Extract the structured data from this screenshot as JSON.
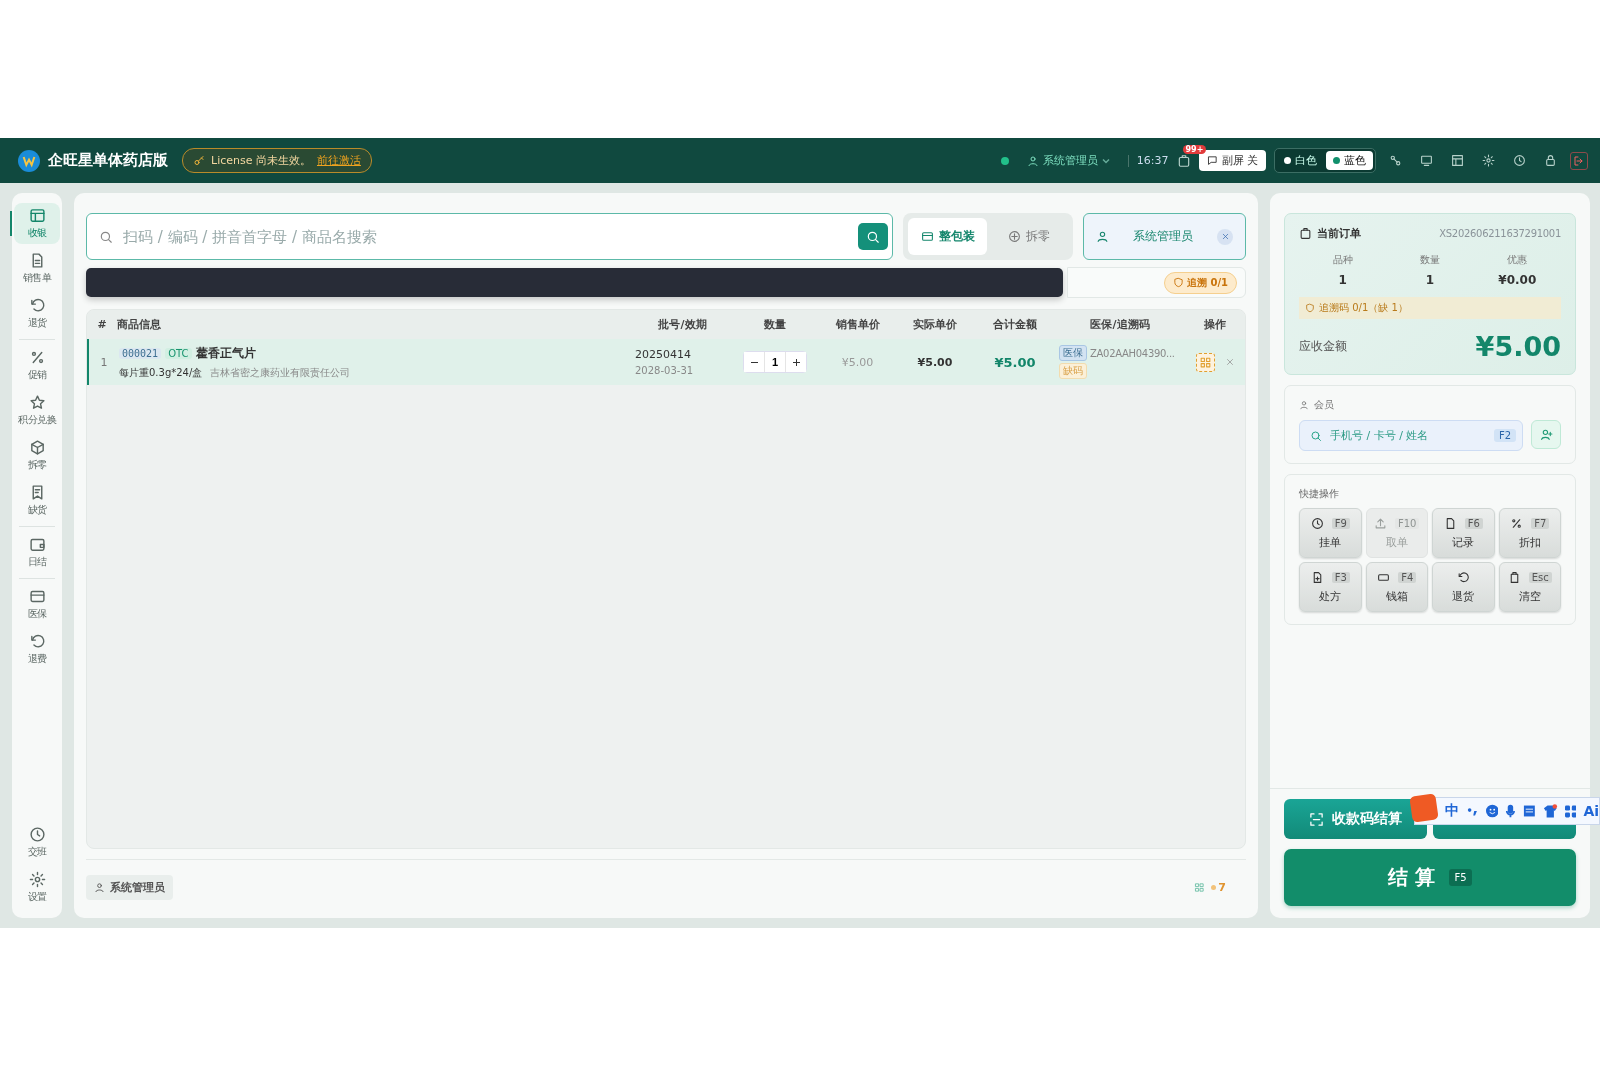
{
  "header": {
    "app_title": "企旺星单体药店版",
    "license_text": "License 尚未生效。",
    "license_link": "前往激活",
    "online": true,
    "user": "系统管理员",
    "time": "16:37",
    "notification_badge": "99+",
    "second_screen": "副屏 关",
    "themes": [
      {
        "label": "白色",
        "selected": false
      },
      {
        "label": "蓝色",
        "selected": true
      }
    ]
  },
  "sidebar": {
    "groups": [
      [
        {
          "label": "收银",
          "selected": true
        },
        {
          "label": "销售单",
          "selected": false
        },
        {
          "label": "退货",
          "selected": false
        }
      ],
      [
        {
          "label": "促销",
          "selected": false
        },
        {
          "label": "积分兑换",
          "selected": false
        },
        {
          "label": "拆零",
          "selected": false
        },
        {
          "label": "缺货",
          "selected": false
        }
      ],
      [
        {
          "label": "日结",
          "selected": false
        }
      ],
      [
        {
          "label": "医保",
          "selected": false
        },
        {
          "label": "退费",
          "selected": false
        }
      ]
    ],
    "bottom_items": [
      {
        "label": "交班",
        "selected": false
      },
      {
        "label": "设置",
        "selected": false
      }
    ]
  },
  "search": {
    "placeholder": "扫码 / 编码 / 拼音首字母 / 商品名搜索"
  },
  "pack_modes": [
    {
      "label": "整包装",
      "selected": true
    },
    {
      "label": "拆零",
      "selected": false
    }
  ],
  "cashier_chip": "系统管理员",
  "trace_badge": "追溯 0/1",
  "table": {
    "columns": [
      "#",
      "商品信息",
      "批号/效期",
      "数量",
      "销售单价",
      "实际单价",
      "合计金额",
      "医保/追溯码",
      "操作"
    ],
    "rows": [
      {
        "index": "1",
        "selected": true,
        "code": "000021",
        "tag": "OTC",
        "name": "藿香正气片",
        "spec": "每片重0.3g*24/盒",
        "maker": "吉林省密之康药业有限责任公司",
        "batch": "20250414",
        "expiry": "2028-03-31",
        "qty": "1",
        "sale_price": "¥5.00",
        "actual_price": "¥5.00",
        "total": "¥5.00",
        "insurance_tag": "医保",
        "trace_code": "ZA02AAH04390...",
        "missing_tag": "缺码"
      }
    ]
  },
  "footer": {
    "operator": "系统管理员",
    "count": "7"
  },
  "order": {
    "title": "当前订单",
    "number": "XS202606211637291001",
    "stats": [
      {
        "label": "品种",
        "value": "1"
      },
      {
        "label": "数量",
        "value": "1"
      },
      {
        "label": "优惠",
        "value": "¥0.00"
      }
    ],
    "trace_warning": "追溯码 0/1（缺 1）",
    "due_label": "应收金额",
    "due": "¥5.00"
  },
  "member": {
    "label": "会员",
    "placeholder": "手机号 / 卡号 / 姓名",
    "key": "F2"
  },
  "quick": {
    "title": "快捷操作",
    "actions": [
      {
        "label": "挂单",
        "key": "F9",
        "disabled": false
      },
      {
        "label": "取单",
        "key": "F10",
        "disabled": true
      },
      {
        "label": "记录",
        "key": "F6",
        "disabled": false
      },
      {
        "label": "折扣",
        "key": "F7",
        "disabled": false
      },
      {
        "label": "处方",
        "key": "F3",
        "disabled": false
      },
      {
        "label": "钱箱",
        "key": "F4",
        "disabled": false
      },
      {
        "label": "退货",
        "disabled": false
      },
      {
        "label": "清空",
        "key": "Esc",
        "disabled": false
      }
    ]
  },
  "pay_button": "收款码结算",
  "checkout": {
    "label": "结 算",
    "key": "F5"
  },
  "ime": {
    "mode": "中",
    "ai": "Ai"
  }
}
